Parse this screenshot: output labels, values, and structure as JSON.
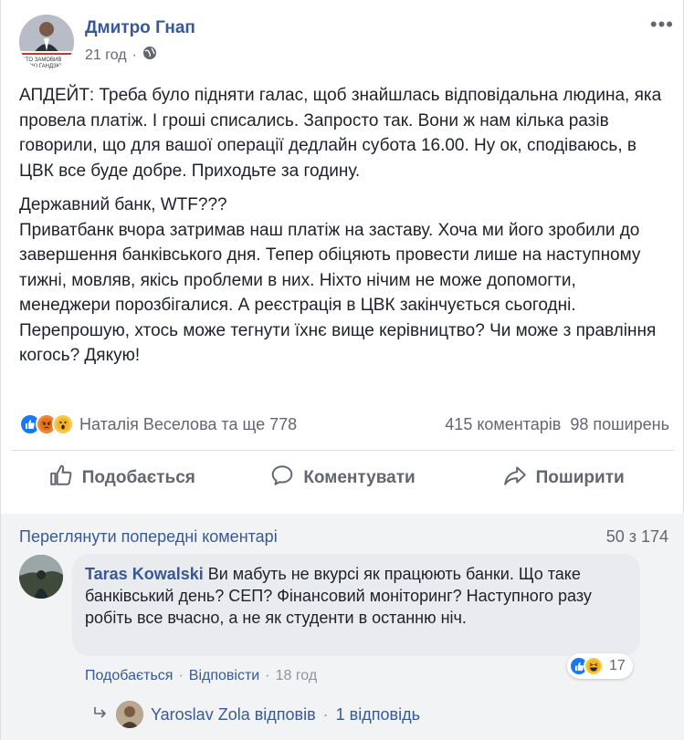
{
  "post": {
    "author": "Дмитро Гнап",
    "time": "21 год",
    "privacy_icon": "globe-icon",
    "avatar_caption": "ХТО ЗАМОВИВ",
    "avatar_caption2": "ЮЮ ГАНДЗЮ",
    "paragraphs": [
      "АПДЕЙТ: Треба було підняти галас, щоб знайшлась відповідальна людина, яка провела платіж. І гроші списались. Запросто так. Вони ж нам кілька разів говорили, що для вашої операції дедлайн субота 16.00. Ну ок, сподіваюсь, в ЦВК все буде добре. Приходьте за годину.",
      "Державний банк, WTF???",
      "Приватбанк вчора затримав наш платіж на заставу. Хоча ми його зробили до завершення банківського дня. Тепер обіцяють провести лише на наступному тижні, мовляв, якісь проблеми в них. Ніхто нічим не може допомогти, менеджери порозбігалися. А реєстрація в ЦВК закінчується сьогодні.",
      "Перепрошую, хтось може тегнути їхнє вище керівництво? Чи може з правління когось? Дякую!"
    ]
  },
  "reactions": {
    "icons": [
      "like-icon",
      "angry-icon",
      "wow-icon"
    ],
    "names": "Наталія Веселова та ще 778",
    "comments": "415 коментарів",
    "shares": "98 поширень"
  },
  "actions": {
    "like": "Подобається",
    "comment": "Коментувати",
    "share": "Поширити"
  },
  "comments_section": {
    "view_previous": "Переглянути попередні коментарі",
    "count": "50 з 174",
    "comment": {
      "author": "Taras Kowalski",
      "text": " Ви мабуть не вкурсі як працюють банки. Що таке банківський день? СЕП? Фінансовий моніторинг? Наступного разу робіть все вчасно, а не як студенти в останню ніч.",
      "reaction_count": "17",
      "like_link": "Подобається",
      "reply_link": "Відповісти",
      "time": "18 год"
    },
    "reply_summary": {
      "text": "Yaroslav Zola відповів",
      "count": "1 відповідь"
    }
  },
  "colors": {
    "link": "#385898",
    "muted": "#606770",
    "like_blue": "#1877f2"
  }
}
